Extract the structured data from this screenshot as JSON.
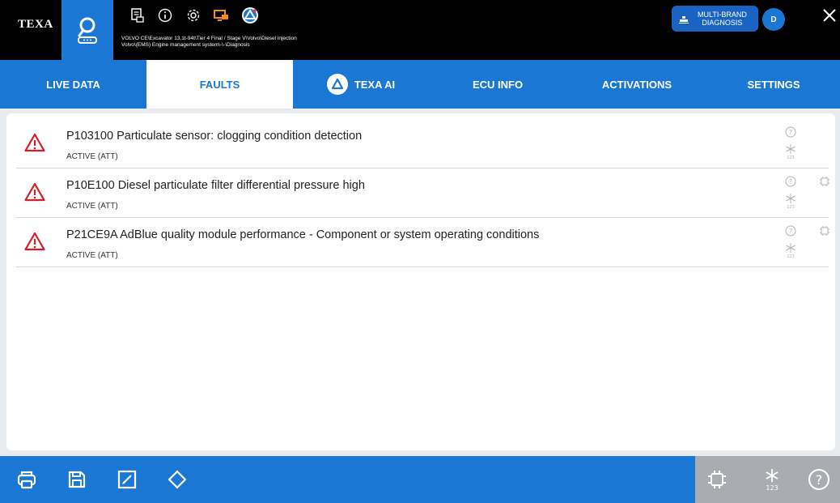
{
  "header": {
    "logo_text": "TEXA",
    "vehicle_line1": "VOLVO CE\\Excavator 13,1t-94t\\Tier 4 Final / Stage V\\Volvo\\Diesel injection",
    "vehicle_line2": "Volvo\\(EMS) Engine management system\\-\\-\\Diagnosis",
    "multibrand_line1": "MULTI-BRAND",
    "multibrand_line2": "DIAGNOSIS",
    "avatar_initial": "D",
    "top_icons": [
      "report-icon",
      "info-icon",
      "settings-gear-icon",
      "remote-screen-icon",
      "texa-ai-logo-icon"
    ]
  },
  "tabs": [
    {
      "label": "LIVE DATA",
      "active": false
    },
    {
      "label": "FAULTS",
      "active": true
    },
    {
      "label": "TEXA AI",
      "active": false
    },
    {
      "label": "ECU INFO",
      "active": false
    },
    {
      "label": "ACTIVATIONS",
      "active": false
    },
    {
      "label": "SETTINGS",
      "active": false
    }
  ],
  "faults": [
    {
      "code_desc": "P103100 Particulate sensor: clogging condition detection",
      "status": "ACTIVE (ATT)",
      "has_ecu_icon": false
    },
    {
      "code_desc": "P10E100 Diesel particulate filter differential pressure high",
      "status": "ACTIVE (ATT)",
      "has_ecu_icon": true
    },
    {
      "code_desc": "P21CE9A AdBlue quality module performance - Component or system operating conditions",
      "status": "ACTIVE (ATT)",
      "has_ecu_icon": true
    }
  ],
  "bottom_toolbar": {
    "left_icons": [
      "print-icon",
      "save-icon",
      "edit-report-icon",
      "erase-icon"
    ],
    "right_icons": [
      "ecu-icon",
      "freeze-frame-icon",
      "help-icon"
    ]
  },
  "colors": {
    "primary_blue": "#1a78d4",
    "warning_red": "#d21f2a",
    "header_black": "#000000",
    "disabled_gray": "#a9adb2"
  }
}
